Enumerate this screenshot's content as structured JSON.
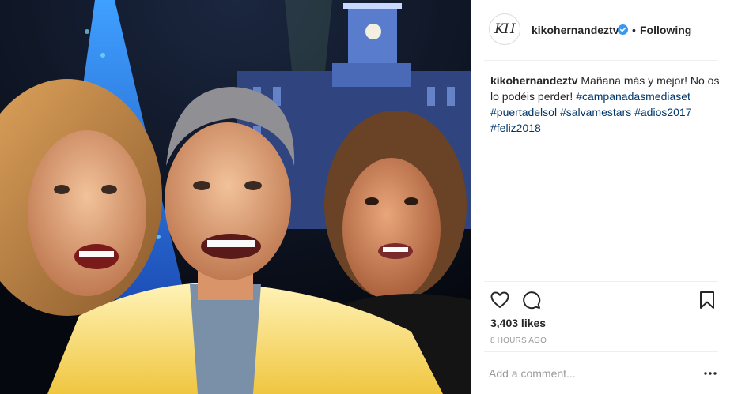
{
  "post": {
    "username": "kikohernandeztv",
    "avatar_initials": "KH",
    "separator": "•",
    "follow_status": "Following",
    "caption": {
      "username": "kikohernandeztv",
      "text_1": " Mañana más y mejor! No os lo podéis perder! ",
      "hashtags": [
        "#campanadasmediaset",
        "#puertadelsol",
        "#salvamestars",
        "#adios2017",
        "#feliz2018"
      ]
    },
    "likes": "3,403 likes",
    "timestamp": "8 HOURS AGO",
    "comment_placeholder": "Add a comment..."
  },
  "colors": {
    "link": "#003569",
    "verified": "#3897f0",
    "text": "#262626",
    "muted": "#999999"
  },
  "icons": [
    "heart-icon",
    "comment-icon",
    "bookmark-icon",
    "verified-icon",
    "more-options-icon"
  ]
}
